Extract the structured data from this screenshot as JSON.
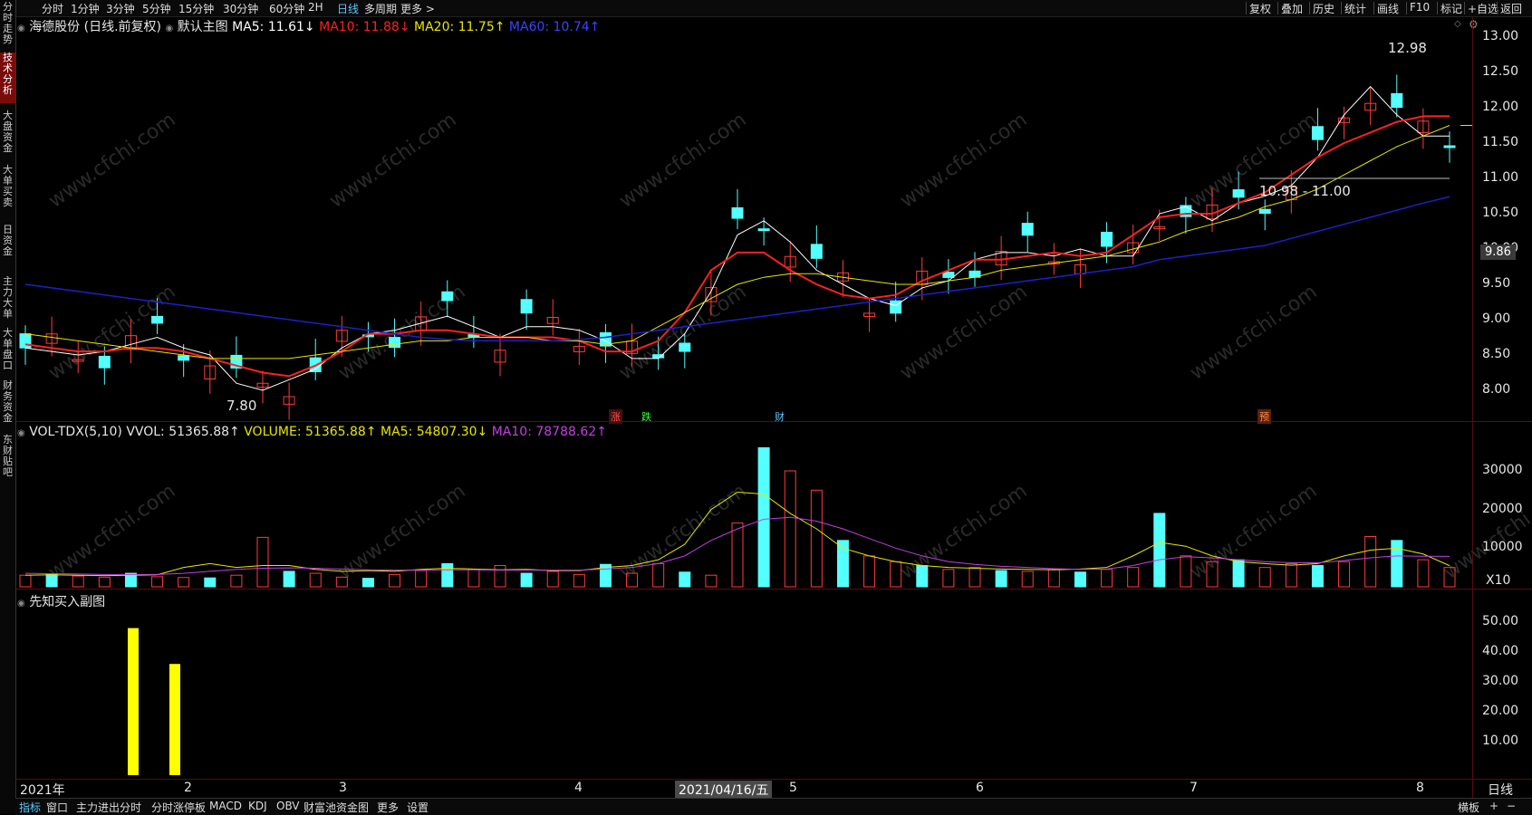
{
  "topbar": {
    "periods": [
      "分时",
      "1分钟",
      "3分钟",
      "5分钟",
      "15分钟",
      "30分钟",
      "60分钟",
      "2H",
      "日线",
      "多周期",
      "更多 >"
    ],
    "active_period": "日线",
    "right": [
      "复权",
      "叠加",
      "历史",
      "统计",
      "画线",
      "F10",
      "标记",
      "+自选",
      "返回"
    ]
  },
  "sidebar": {
    "items": [
      "分时走势",
      "技术分析",
      "大盘资金",
      "大单买卖",
      "日资金",
      "主力大单",
      "大单盘口",
      "财务资金",
      "东财贴吧"
    ],
    "active": "技术分析"
  },
  "main": {
    "stock_title": "海德股份 (日线.前复权)",
    "indicator_name": "默认主图",
    "ma5": "MA5: 11.61↓",
    "ma10": "MA10: 11.88↓",
    "ma20": "MA20: 11.75↑",
    "ma60": "MA60: 10.74↑",
    "y_ticks": [
      "13.00",
      "12.50",
      "12.00",
      "11.50",
      "11.00",
      "10.50",
      "10.00",
      "9.50",
      "9.00",
      "8.50",
      "8.00"
    ],
    "current_price": "9.86",
    "high_label": "12.98",
    "low_label": "7.80",
    "range_label": "10.98 - 11.00",
    "event_marks": [
      "涨",
      "跌",
      "财",
      "预"
    ]
  },
  "volume": {
    "title": "VOL-TDX(5,10) VVOL: 51365.88↑",
    "volume": "VOLUME: 51365.88↑",
    "ma5": "MA5: 54807.30↓",
    "ma10": "MA10: 78788.62↑",
    "y_ticks": [
      "30000",
      "20000",
      "10000"
    ],
    "unit": "X10"
  },
  "sub": {
    "title": "先知买入副图",
    "y_ticks": [
      "50.00",
      "40.00",
      "30.00",
      "20.00",
      "10.00"
    ]
  },
  "xaxis": {
    "labels": [
      "2021年",
      "2",
      "3",
      "4",
      "5",
      "6",
      "7",
      "8"
    ],
    "cursor_date": "2021/04/16/五",
    "period": "日线"
  },
  "bottombar": {
    "tabs": [
      "指标",
      "窗口",
      "主力进出分时",
      "分时涨停板",
      "MACD",
      "KDJ",
      "OBV",
      "财富池资金图",
      "更多",
      "设置"
    ],
    "active": "指标",
    "right": [
      "横板",
      "+",
      "−"
    ]
  },
  "watermark": "www.cfchi.com",
  "colors": {
    "up": "#ff3b3b",
    "down": "#54ffff",
    "ma5": "#ffffff",
    "ma10": "#ff2020",
    "ma20": "#e6e600",
    "ma60": "#1a22c8",
    "vol_ma5": "#e6e600",
    "vol_ma10": "#c040e0",
    "sub_bar": "#ffff00"
  },
  "chart_data": [
    {
      "type": "line",
      "title": "海德股份 (日线.前复权)",
      "series": [
        {
          "name": "MA5",
          "values": [
            8.6,
            8.55,
            8.5,
            8.55,
            8.65,
            8.75,
            8.6,
            8.5,
            8.1,
            8.0,
            8.15,
            8.3,
            8.6,
            8.8,
            8.85,
            8.95,
            9.05,
            8.9,
            8.75,
            8.9,
            8.9,
            8.85,
            8.7,
            8.45,
            8.45,
            8.8,
            9.4,
            10.2,
            10.4,
            10.1,
            9.7,
            9.5,
            9.3,
            9.2,
            9.45,
            9.55,
            9.85,
            9.95,
            9.95,
            9.9,
            10.0,
            9.9,
            9.9,
            10.5,
            10.6,
            10.4,
            10.65,
            10.75,
            10.9,
            11.3,
            11.9,
            12.3,
            11.9,
            11.6,
            11.6
          ]
        },
        {
          "name": "MA10",
          "values": [
            8.65,
            8.6,
            8.55,
            8.55,
            8.6,
            8.6,
            8.55,
            8.45,
            8.35,
            8.25,
            8.2,
            8.35,
            8.55,
            8.8,
            8.8,
            8.85,
            8.85,
            8.8,
            8.75,
            8.75,
            8.75,
            8.7,
            8.55,
            8.55,
            8.7,
            9.1,
            9.7,
            9.95,
            9.95,
            9.7,
            9.5,
            9.35,
            9.3,
            9.35,
            9.55,
            9.7,
            9.85,
            9.85,
            9.9,
            9.95,
            9.9,
            9.95,
            10.2,
            10.45,
            10.5,
            10.5,
            10.65,
            10.8,
            11.05,
            11.3,
            11.5,
            11.65,
            11.8,
            11.88,
            11.88
          ]
        },
        {
          "name": "MA20",
          "values": [
            8.8,
            8.75,
            8.7,
            8.65,
            8.6,
            8.55,
            8.5,
            8.45,
            8.45,
            8.45,
            8.45,
            8.5,
            8.55,
            8.6,
            8.65,
            8.7,
            8.7,
            8.75,
            8.75,
            8.75,
            8.7,
            8.7,
            8.65,
            8.7,
            8.9,
            9.1,
            9.3,
            9.5,
            9.6,
            9.65,
            9.65,
            9.6,
            9.55,
            9.5,
            9.5,
            9.55,
            9.6,
            9.7,
            9.75,
            9.8,
            9.85,
            9.9,
            10.0,
            10.1,
            10.25,
            10.35,
            10.45,
            10.6,
            10.7,
            10.85,
            11.05,
            11.25,
            11.45,
            11.6,
            11.75
          ]
        },
        {
          "name": "MA60",
          "values": [
            9.5,
            9.45,
            9.4,
            9.35,
            9.3,
            9.25,
            9.2,
            9.15,
            9.1,
            9.05,
            9.0,
            8.95,
            8.9,
            8.85,
            8.8,
            8.75,
            8.72,
            8.7,
            8.7,
            8.7,
            8.7,
            8.72,
            8.75,
            8.8,
            8.85,
            8.9,
            8.95,
            9.0,
            9.05,
            9.1,
            9.15,
            9.2,
            9.25,
            9.3,
            9.35,
            9.4,
            9.45,
            9.5,
            9.55,
            9.6,
            9.65,
            9.7,
            9.75,
            9.85,
            9.9,
            9.95,
            10.0,
            10.05,
            10.15,
            10.25,
            10.35,
            10.45,
            10.55,
            10.65,
            10.74
          ]
        }
      ],
      "ylim": [
        7.6,
        13.2
      ],
      "annotations": [
        "12.98",
        "7.80",
        "10.98 - 11.00"
      ]
    },
    {
      "type": "bar",
      "title": "VOL-TDX(5,10)",
      "values": [
        3000,
        3200,
        2800,
        2500,
        3500,
        2600,
        2400,
        2300,
        3000,
        12800,
        4000,
        3500,
        2500,
        2200,
        3200,
        4200,
        6000,
        4500,
        5500,
        3500,
        4000,
        3200,
        5800,
        3500,
        6000,
        3800,
        3000,
        16500,
        36000,
        30000,
        25000,
        12000,
        8000,
        6500,
        5500,
        4500,
        5000,
        4200,
        4000,
        4500,
        3800,
        4500,
        5000,
        19000,
        8000,
        6500,
        7000,
        5000,
        6000,
        5500,
        6500,
        13000,
        12000,
        7000,
        5000
      ],
      "series": [
        {
          "name": "MA5",
          "values": [
            3000,
            3100,
            3000,
            2900,
            3000,
            3100,
            5000,
            6000,
            5000,
            5500,
            5500,
            4500,
            4000,
            4200,
            4000,
            4500,
            4800,
            4600,
            4400,
            4500,
            4200,
            4200,
            5000,
            5500,
            7000,
            11000,
            20000,
            24500,
            24000,
            19000,
            15000,
            10000,
            8000,
            6500,
            5500,
            5000,
            4800,
            4600,
            4500,
            4400,
            4600,
            5000,
            8000,
            11500,
            10500,
            8000,
            6500,
            6000,
            5600,
            6000,
            8000,
            9500,
            10000,
            8500,
            5481
          ]
        },
        {
          "name": "MA10",
          "values": [
            3500,
            3400,
            3300,
            3200,
            3200,
            3200,
            3500,
            4000,
            4500,
            4800,
            4900,
            4800,
            4600,
            4400,
            4300,
            4300,
            4400,
            4400,
            4300,
            4300,
            4300,
            4300,
            4600,
            5000,
            6000,
            8000,
            12000,
            15000,
            17500,
            18000,
            17000,
            15000,
            12500,
            10000,
            8000,
            6500,
            5800,
            5300,
            5000,
            4700,
            4500,
            4600,
            5500,
            7000,
            7800,
            7500,
            7000,
            6500,
            6200,
            6200,
            6800,
            7500,
            8000,
            7900,
            7879
          ]
        }
      ],
      "ylim": [
        0,
        38000
      ],
      "unit": "X10"
    },
    {
      "type": "bar",
      "title": "先知买入副图",
      "values": [
        48,
        36
      ],
      "ylim": [
        0,
        55
      ]
    }
  ]
}
